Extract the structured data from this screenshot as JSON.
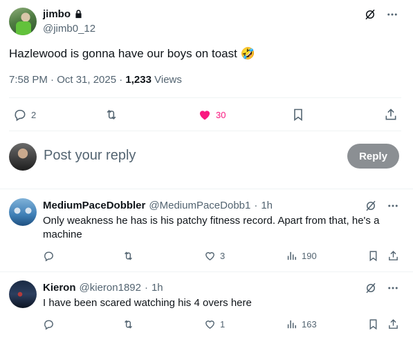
{
  "tweet": {
    "display_name": "jimbo",
    "handle": "@jimb0_12",
    "text": "Hazlewood is gonna have our boys on toast 🤣",
    "time": "7:58 PM · Oct 31, 2025 · ",
    "views_count": "1,233",
    "views_label": " Views",
    "replies": "2",
    "likes": "30",
    "like_color": "#f91880"
  },
  "composer": {
    "placeholder": "Post your reply",
    "reply_label": "Reply"
  },
  "comments": [
    {
      "name": "MediumPaceDobbler",
      "handle": "@MediumPaceDobb1",
      "dot": "·",
      "time": "1h",
      "text": "Only weakness he has is his patchy fitness record. Apart from that, he's a machine",
      "likes": "3",
      "views": "190"
    },
    {
      "name": "Kieron",
      "handle": "@kieron1892",
      "dot": "·",
      "time": "1h",
      "text": "I have been scared watching his 4 overs here",
      "likes": "1",
      "views": "163"
    }
  ],
  "icons": {
    "lock": "lock-icon",
    "grok": "grok-icon",
    "more": "more-icon",
    "reply": "reply-icon",
    "repost": "repost-icon",
    "like": "heart-icon",
    "bookmark": "bookmark-icon",
    "share": "share-icon",
    "views": "views-icon"
  }
}
